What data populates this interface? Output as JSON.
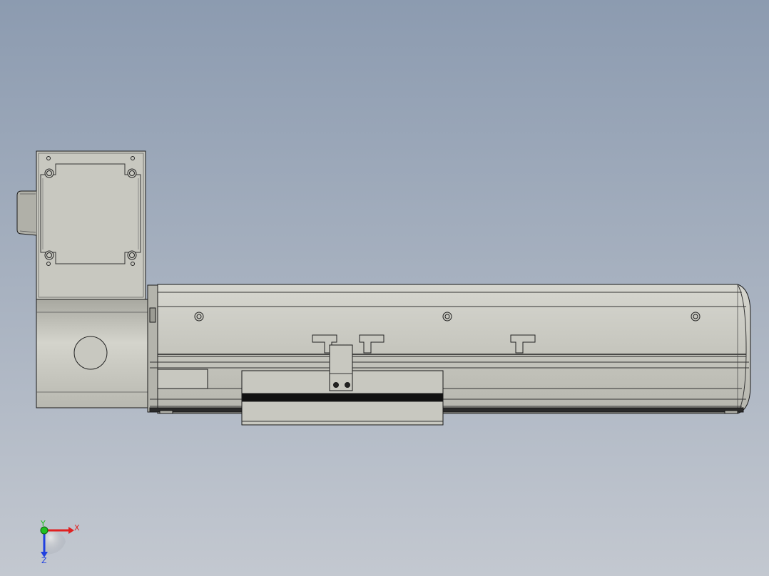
{
  "viewport": {
    "background_top": "#8c9bb0",
    "background_bottom": "#c3c8d0"
  },
  "model": {
    "body_color": "#c8c8c0",
    "edge_color": "#1a1a1a",
    "shade_color": "#a9a9a1",
    "highlight_color": "#e4e4de"
  },
  "triad": {
    "x_label": "X",
    "y_label": "Y",
    "z_label": "Z",
    "x_color": "#e02020",
    "y_color": "#20c020",
    "z_color": "#2040e0"
  }
}
